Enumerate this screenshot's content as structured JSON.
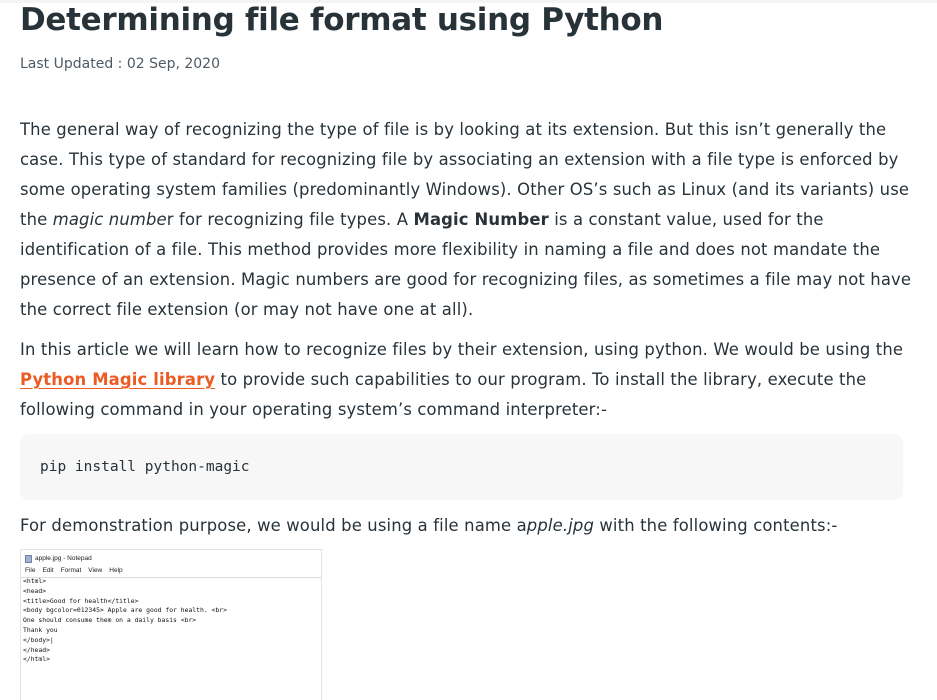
{
  "article": {
    "title": "Determining file format using Python",
    "last_updated": "Last Updated : 02 Sep, 2020",
    "p1": {
      "a": "The general way of recognizing the type of file is by looking at its extension. But this isn’t generally the case. This type of standard for recognizing file by associating an extension with a file type is enforced by some operating system families (predominantly Windows). Other OS’s such as Linux (and its variants) use the ",
      "b_italic": "magic numbe",
      "c": "r for recognizing file types. A ",
      "d_bold": "Magic Number",
      "e": " is a constant value, used for the identification of a file. This method provides more flexibility in naming a file and does not mandate the presence of an extension.  Magic numbers are good for recognizing files, as sometimes a file may not have the correct file extension (or may not have one at all)."
    },
    "p2": {
      "a": "In this article we will learn how to recognize files by their extension, using python. We would be using the ",
      "link": "Python Magic library",
      "b": " to provide such capabilities to our program. To install the library, execute the following command in your operating system’s command interpreter:-"
    },
    "code": "pip install python-magic",
    "p3": {
      "a": "For demonstration purpose, we would be using a file name a",
      "b_italic": "pple.jpg",
      "c": " with the following contents:-"
    }
  },
  "notepad": {
    "title": "apple.jpg - Notepad",
    "menu": [
      "File",
      "Edit",
      "Format",
      "View",
      "Help"
    ],
    "lines": [
      "<html>",
      "<head>",
      "<title>Good for health</title>",
      "<body bgcolor=012345> Apple are good for health. <br>",
      "One should consume them on a daily basis <br>",
      "Thank you",
      "</body>|",
      "</head>",
      "</html>"
    ]
  },
  "colors": {
    "text": "#273239",
    "link": "#ec5b24",
    "code_bg": "#f7f7f7"
  }
}
